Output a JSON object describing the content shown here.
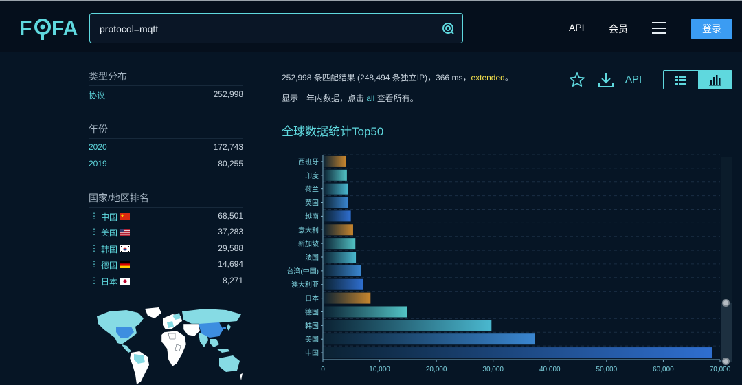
{
  "header": {
    "logo_text": "FOFA",
    "search_value": "protocol=mqtt",
    "nav": [
      "API",
      "会员"
    ],
    "login_label": "登录"
  },
  "sidebar": {
    "type_dist": {
      "title": "类型分布",
      "items": [
        {
          "label": "协议",
          "value": "252,998"
        }
      ]
    },
    "year": {
      "title": "年份",
      "items": [
        {
          "label": "2020",
          "value": "172,743"
        },
        {
          "label": "2019",
          "value": "80,255"
        }
      ]
    },
    "country": {
      "title": "国家/地区排名",
      "items": [
        {
          "label": "中国",
          "value": "68,501",
          "flag": "cn"
        },
        {
          "label": "美国",
          "value": "37,283",
          "flag": "us"
        },
        {
          "label": "韩国",
          "value": "29,588",
          "flag": "kr"
        },
        {
          "label": "德国",
          "value": "14,694",
          "flag": "de"
        },
        {
          "label": "日本",
          "value": "8,271",
          "flag": "jp"
        }
      ]
    }
  },
  "results": {
    "summary_prefix": "252,998 条匹配结果 (248,494 条独立IP)，366 ms，",
    "extended": "extended",
    "summary_suffix": "。",
    "notice_prefix": "显示一年内数据，点击 ",
    "notice_all": "all",
    "notice_suffix": " 查看所有。",
    "api_label": "API"
  },
  "chart_title": "全球数据统计Top50",
  "chart_data": {
    "type": "bar",
    "orientation": "horizontal",
    "categories": [
      "西班牙",
      "印度",
      "荷兰",
      "英国",
      "越南",
      "意大利",
      "新加坡",
      "法国",
      "台湾(中国)",
      "澳大利亚",
      "日本",
      "德国",
      "韩国",
      "美国",
      "中国"
    ],
    "values": [
      3900,
      4100,
      4300,
      4300,
      4800,
      5200,
      5600,
      5700,
      6600,
      7000,
      8271,
      14694,
      29588,
      37283,
      68501
    ],
    "colors": [
      "#c8862e",
      "#52c3c5",
      "#4ab8cf",
      "#3a86d0",
      "#2f6fd0",
      "#c8862e",
      "#52c3c5",
      "#4ab8cf",
      "#3a86d0",
      "#2f6fd0",
      "#c8862e",
      "#52c3c5",
      "#4ab8cf",
      "#3a86d0",
      "#2f6fd0"
    ],
    "xlim": [
      0,
      70000
    ],
    "xticks": [
      0,
      10000,
      20000,
      30000,
      40000,
      50000,
      60000,
      70000
    ],
    "xtick_labels": [
      "0",
      "10,000",
      "20,000",
      "30,000",
      "40,000",
      "50,000",
      "60,000",
      "70,000"
    ],
    "grid": true
  }
}
